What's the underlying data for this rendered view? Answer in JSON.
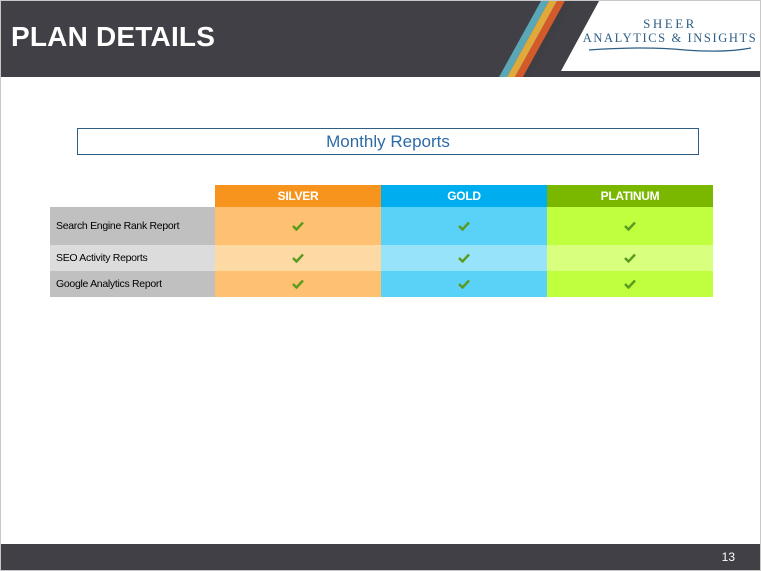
{
  "header": {
    "title": "PLAN DETAILS",
    "logo": {
      "line1": "SHEER",
      "line2": "ANALYTICS & INSIGHTS"
    }
  },
  "colors": {
    "header_bg": "#414046",
    "silver": "#f7941d",
    "gold": "#00aeef",
    "platinum": "#7ab800",
    "accent_blue": "#2e5e85",
    "check": "#5a9a1f"
  },
  "section": {
    "title": "Monthly Reports"
  },
  "table": {
    "columns": [
      "SILVER",
      "GOLD",
      "PLATINUM"
    ],
    "rows": [
      {
        "label": "Search Engine Rank Report",
        "values": [
          "check-icon",
          "check-icon",
          "check-icon"
        ]
      },
      {
        "label": "SEO Activity Reports",
        "values": [
          "check-icon",
          "check-icon",
          "check-icon"
        ]
      },
      {
        "label": "Google Analytics Report",
        "values": [
          "check-icon",
          "check-icon",
          "check-icon"
        ]
      }
    ]
  },
  "footer": {
    "page_number": "13"
  }
}
